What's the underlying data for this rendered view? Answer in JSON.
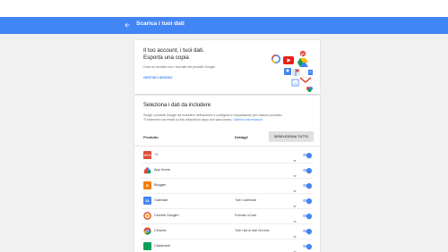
{
  "appbar": {
    "title": "Scarica i tuoi dati"
  },
  "account_card": {
    "title_line1": "Il tuo account, i tuoi dati.",
    "title_line2": "Esporta una copia",
    "description": "Crea un archivio con i tuoi dati dei prodotti Google.",
    "manage_link": "GESTISCI ARCHIVI"
  },
  "select_card": {
    "title": "Seleziona i dati da includere",
    "description_line1": "Scegli i prodotti Google da includere nell'archivio e configura le impostazioni per ciascun prodotto.",
    "description_line2": "Ulteriori informazioni",
    "description_prefix2": "Ti invieremo via email un link all'archivio dopo che sarà creato. ",
    "col_product": "Prodotto",
    "col_details": "Dettagli",
    "deselect_all": "DESELEZIONA TUTTO"
  },
  "products": [
    {
      "name": "+1",
      "icon": "google-plus-one-icon",
      "color": "#dd4b39",
      "glyph": "G+1",
      "setting": "",
      "enabled": true
    },
    {
      "name": "App Home",
      "icon": "google-home-icon",
      "color": "#ffffff",
      "glyph": "",
      "setting": "",
      "enabled": true
    },
    {
      "name": "Blogger",
      "icon": "blogger-icon",
      "color": "#f57d00",
      "glyph": "B",
      "setting": "",
      "enabled": true
    },
    {
      "name": "Calendar",
      "icon": "calendar-icon",
      "color": "#4285f4",
      "glyph": "31",
      "setting": "Tutti i calendari",
      "enabled": true
    },
    {
      "name": "Cerchie Google+",
      "icon": "google-plus-circles-icon",
      "color": "#ffffff",
      "glyph": "",
      "setting": "Formato vCard",
      "enabled": true
    },
    {
      "name": "Chrome",
      "icon": "chrome-icon",
      "color": "#ffffff",
      "glyph": "",
      "setting": "Tutti i tipi di dati Chrome",
      "enabled": true
    },
    {
      "name": "Classroom",
      "icon": "classroom-icon",
      "color": "#0f9d58",
      "glyph": "",
      "setting": "",
      "enabled": true
    }
  ],
  "colors": {
    "primary": "#4285f4",
    "toggle_track": "#a7c4f6"
  }
}
